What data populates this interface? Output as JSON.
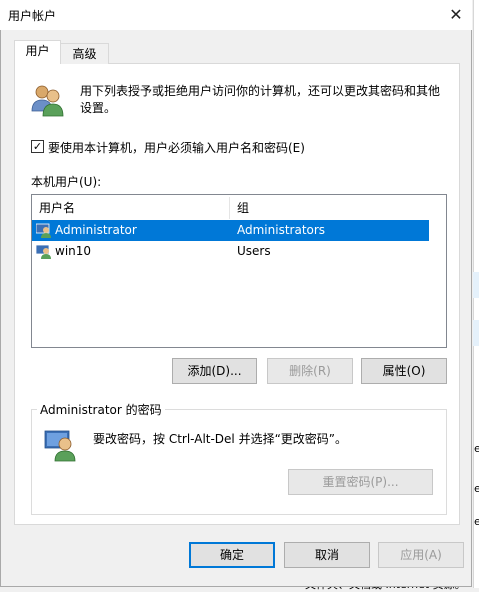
{
  "window": {
    "title": "用户帐户",
    "close_symbol": "✕"
  },
  "tabs": [
    {
      "label": "用户"
    },
    {
      "label": "高级"
    }
  ],
  "intro_text_line1": "用下列表授予或拒绝用户访问你的计算机，还可以更改其密码和其他",
  "intro_text_line2": "设置。",
  "require_login_checkbox": {
    "checked": true,
    "label": "要使用本计算机，用户必须输入用户名和密码(E)"
  },
  "users_label": "本机用户(U):",
  "table": {
    "columns": [
      "用户名",
      "组"
    ],
    "rows": [
      {
        "name": "Administrator",
        "group": "Administrators",
        "selected": true
      },
      {
        "name": "win10",
        "group": "Users",
        "selected": false
      }
    ]
  },
  "buttons": {
    "add": "添加(D)...",
    "remove": "删除(R)",
    "properties": "属性(O)"
  },
  "password_group": {
    "title": "Administrator 的密码",
    "text": "要改密码，按 Ctrl-Alt-Del 并选择“更改密码”。",
    "reset_button": "重置密码(P)..."
  },
  "footer": {
    "ok": "确定",
    "cancel": "取消",
    "apply": "应用(A)"
  },
  "background_fragments": {
    "frag1": "e",
    "frag2": "e",
    "frag3": "e",
    "frag4": "文件夹、文档或 Internet 资源。"
  },
  "colors": {
    "selection": "#0078d7",
    "accent": "#0078d7"
  }
}
